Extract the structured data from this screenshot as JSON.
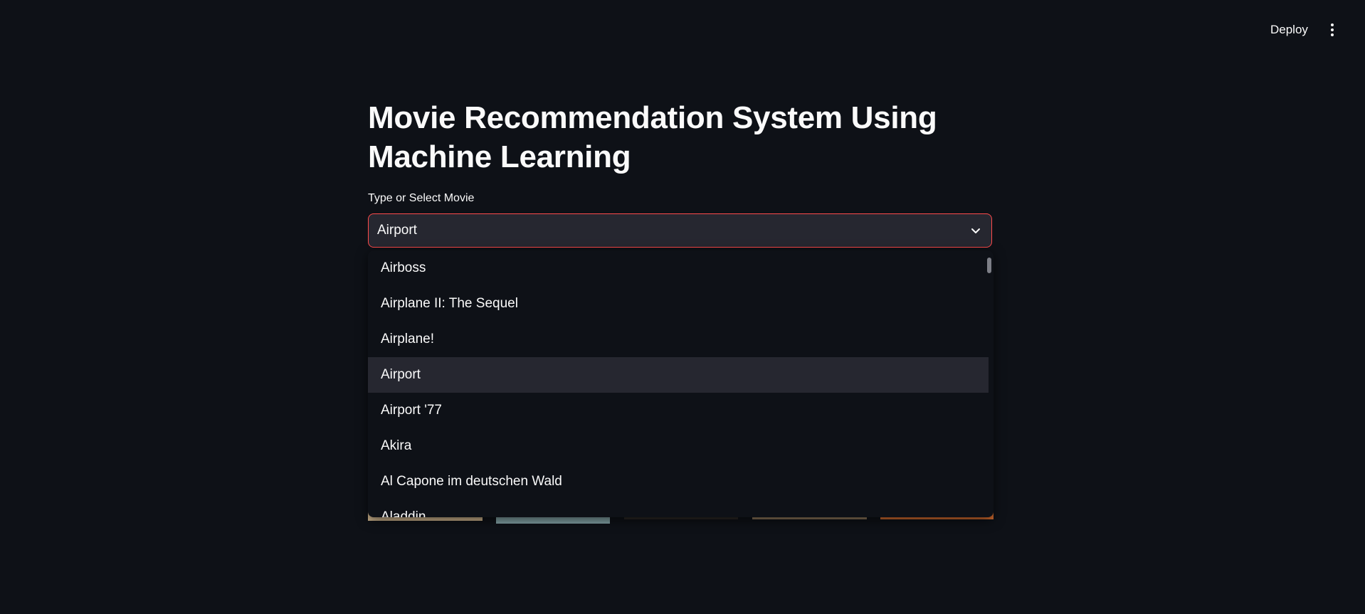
{
  "header": {
    "deploy_label": "Deploy",
    "menu_icon": "vertical-ellipsis-icon"
  },
  "main": {
    "title": "Movie Recommendation System Using Machine Learning",
    "select": {
      "label": "Type or Select Movie",
      "value": "Airport",
      "icon": "chevron-down-icon",
      "focus_border_color": "#ff4b4b"
    },
    "dropdown": {
      "options": [
        "Airboss",
        "Airplane II: The Sequel",
        "Airplane!",
        "Airport",
        "Airport '77",
        "Akira",
        "Al Capone im deutschen Wald",
        "Aladdin"
      ],
      "selected_index": 3
    }
  },
  "colors": {
    "background": "#0e1117",
    "surface": "#262730",
    "text": "#fafafa",
    "accent": "#ff4b4b"
  }
}
